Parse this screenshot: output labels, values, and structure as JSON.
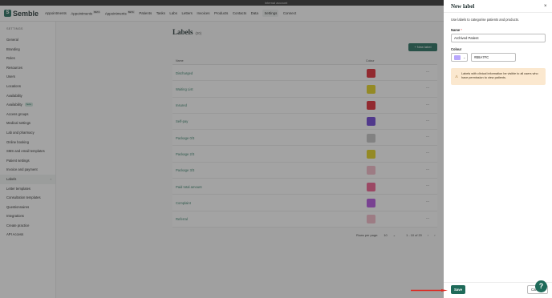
{
  "topbar": {
    "text": "Internal account"
  },
  "brand": {
    "mark": "S",
    "name": "Semble"
  },
  "nav": [
    {
      "label": "Appointments",
      "badge": ""
    },
    {
      "label": "Appointments",
      "badge": "BETA"
    },
    {
      "label": "Appointments",
      "badge": "BETA"
    },
    {
      "label": "Patients",
      "badge": ""
    },
    {
      "label": "Tasks",
      "badge": ""
    },
    {
      "label": "Labs",
      "badge": ""
    },
    {
      "label": "Letters",
      "badge": ""
    },
    {
      "label": "Invoices",
      "badge": ""
    },
    {
      "label": "Products",
      "badge": ""
    },
    {
      "label": "Contacts",
      "badge": ""
    },
    {
      "label": "Data",
      "badge": ""
    },
    {
      "label": "Settings",
      "badge": ""
    },
    {
      "label": "Connect",
      "badge": ""
    }
  ],
  "sidebar": {
    "heading": "SETTINGS",
    "items": [
      {
        "label": "General"
      },
      {
        "label": "Branding"
      },
      {
        "label": "Roles"
      },
      {
        "label": "Resources"
      },
      {
        "label": "Users"
      },
      {
        "label": "Locations"
      },
      {
        "label": "Availability"
      },
      {
        "label": "Availability",
        "badge": "beta"
      },
      {
        "label": "Access groups"
      },
      {
        "label": "Medical settings"
      },
      {
        "label": "Lab and pharmacy"
      },
      {
        "label": "Online booking"
      },
      {
        "label": "SMS and email templates"
      },
      {
        "label": "Patient settings"
      },
      {
        "label": "Invoice and payment"
      },
      {
        "label": "Labels",
        "active": true
      },
      {
        "label": "Letter templates"
      },
      {
        "label": "Consultation templates"
      },
      {
        "label": "Questionnaires"
      },
      {
        "label": "Integrations"
      },
      {
        "label": "Create practice"
      },
      {
        "label": "API Access"
      }
    ]
  },
  "main": {
    "title": "Labels",
    "count": "(20)",
    "new_button": "+ New label",
    "columns": {
      "name": "Name",
      "colour": "Colour"
    },
    "rows": [
      {
        "name": "Discharged",
        "color": "#e0242f"
      },
      {
        "name": "Waiting List",
        "color": "#e3d21a"
      },
      {
        "name": "Insured",
        "color": "#e0242f"
      },
      {
        "name": "Self-pay",
        "color": "#6a3fd6"
      },
      {
        "name": "Package 0/3",
        "color": "#c4c4c4"
      },
      {
        "name": "Package 2/3",
        "color": "#e3d21a"
      },
      {
        "name": "Package 3/3",
        "color": "#f4b8c6"
      },
      {
        "name": "Paid total amount",
        "color": "#f05a8c"
      },
      {
        "name": "Complaint",
        "color": "#b24fe0"
      },
      {
        "name": "Referral",
        "color": "#f4b8c6"
      }
    ],
    "row_menu": "···",
    "pager": {
      "rows_per_page_label": "Rows per page:",
      "rows_per_page": "10",
      "range": "1 - 10 of 20",
      "prev": "‹",
      "next": "›"
    }
  },
  "panel": {
    "title": "New label",
    "close": "×",
    "description": "Use labels to categorise patients and products.",
    "name_label": "Name",
    "required_mark": "*",
    "name_value": "Archived Patient",
    "colour_label": "Colour",
    "colour_swatch": "#B8A7FC",
    "colour_hex": "#B8A7FC",
    "warning_icon": "⚠",
    "warning": "Labels with clinical information be visible to all users who have permission to view patients.",
    "save": "Save",
    "cancel": "Cancel"
  },
  "help": {
    "label": "?"
  },
  "colors": {
    "brand": "#1f6b5a",
    "arrow": "#e0241d"
  }
}
